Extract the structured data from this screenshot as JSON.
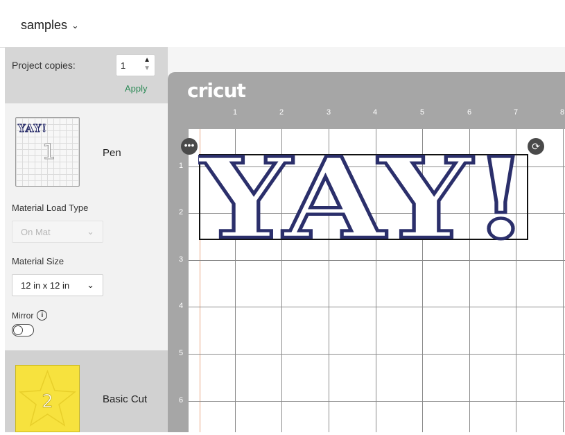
{
  "header": {
    "title": "samples"
  },
  "panel": {
    "copies_label": "Project copies:",
    "copies_value": "1",
    "apply_label": "Apply",
    "mats": [
      {
        "name": "Pen",
        "thumb_text": "YAY!",
        "thumb_number": "1"
      },
      {
        "name": "Basic Cut",
        "thumb_number": "2"
      }
    ],
    "material_load_type": {
      "label": "Material Load Type",
      "value": "On Mat"
    },
    "material_size": {
      "label": "Material Size",
      "value": "12 in x 12 in"
    },
    "mirror": {
      "label": "Mirror",
      "info": "i",
      "on": false
    }
  },
  "canvas": {
    "brand": "cricut",
    "ruler_x": [
      "1",
      "2",
      "3",
      "4",
      "5",
      "6",
      "7",
      "8"
    ],
    "ruler_y": [
      "1",
      "2",
      "3",
      "4",
      "5",
      "6"
    ],
    "design_text": "YAY!",
    "more_icon": "•••",
    "rotate_icon": "⟳"
  },
  "colors": {
    "accent_green": "#2d8a57",
    "design_stroke": "#2b2f6b",
    "mat_gray": "#a6a6a6",
    "second_mat": "#f7e23e"
  }
}
